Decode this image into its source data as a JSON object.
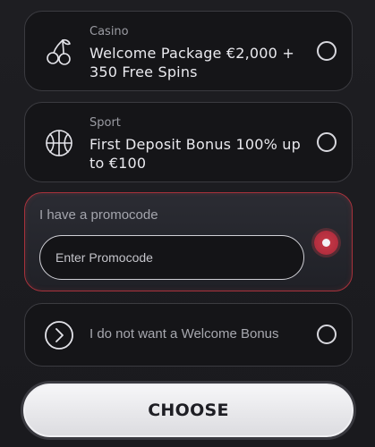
{
  "options": {
    "casino": {
      "category": "Casino",
      "title": "Welcome Package €2,000 + 350 Free Spins",
      "icon": "cherries-icon",
      "selected": false
    },
    "sport": {
      "category": "Sport",
      "title": "First Deposit Bonus 100% up to €100",
      "icon": "basketball-icon",
      "selected": false
    },
    "promo": {
      "label": "I have a promocode",
      "input_placeholder": "Enter Promocode",
      "input_value": "",
      "selected": true,
      "accent_color": "#a8323c"
    },
    "none": {
      "label": "I do not want a Welcome Bonus",
      "icon": "chevron-right-circle-icon",
      "selected": false
    }
  },
  "actions": {
    "choose_label": "CHOOSE"
  }
}
